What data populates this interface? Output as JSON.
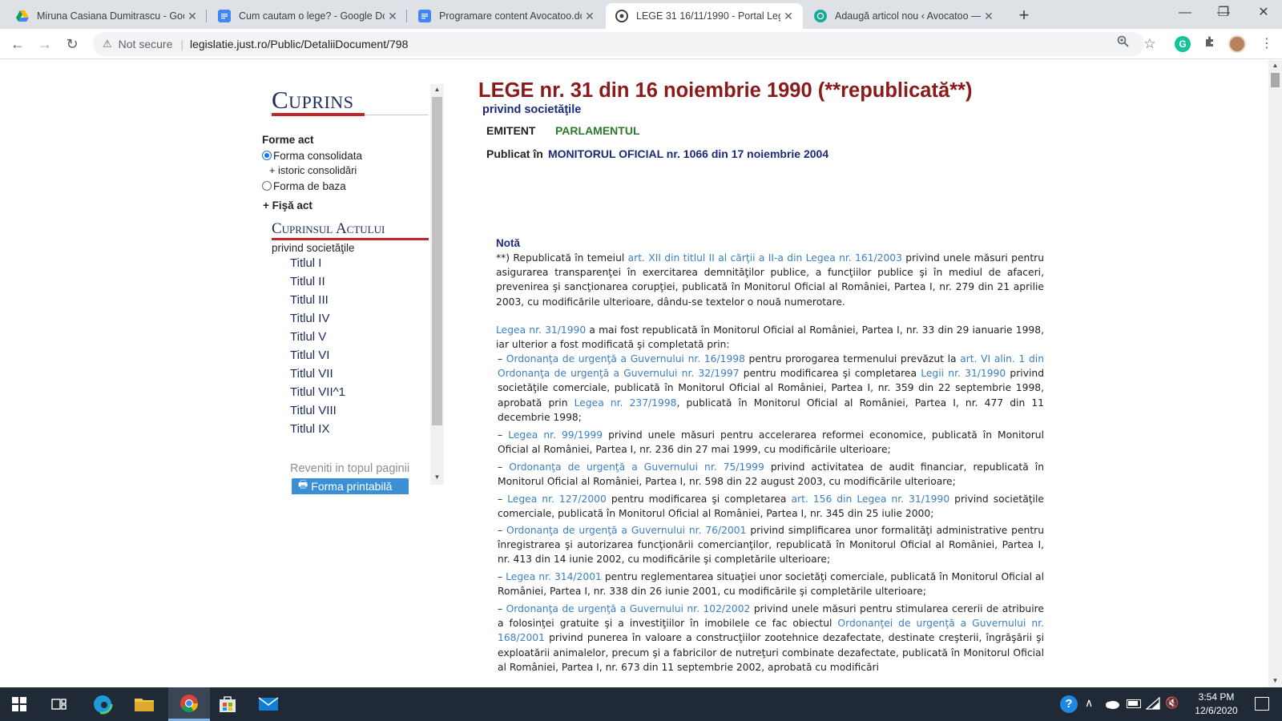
{
  "browser": {
    "tabs": [
      {
        "label": "Miruna Casiana Dumitrascu - Goo",
        "icon": "google-drive-icon"
      },
      {
        "label": "Cum cautam o lege? - Google Do",
        "icon": "google-docs-icon"
      },
      {
        "label": "Programare content Avocatoo.do",
        "icon": "google-docs-icon"
      },
      {
        "label": "LEGE 31 16/11/1990 - Portal Legi",
        "icon": "portal-legislativ-icon",
        "active": true
      },
      {
        "label": "Adaugă articol nou ‹ Avocatoo —",
        "icon": "wordpress-icon"
      }
    ],
    "security_label": "Not secure",
    "url": "legislatie.just.ro/Public/DetaliiDocument/798"
  },
  "sidebar": {
    "heading": "Cuprins",
    "forme_act_label": "Forme act",
    "forma_consolidata": "Forma consolidata",
    "istoric": "+ istoric consolidări",
    "forma_baza": "Forma de baza",
    "fisa_act": "+ Fişă act",
    "cuprinsul_heading": "Cuprinsul Actului",
    "cuprinsul_sub": "privind societăţile",
    "titluri": [
      "Titlul I",
      "Titlul II",
      "Titlul III",
      "Titlul IV",
      "Titlul V",
      "Titlul VI",
      "Titlul VII",
      "Titlul VII^1",
      "Titlul VIII",
      "Titlul IX"
    ],
    "back_to_top": "Reveniti in topul paginii",
    "print_button": "Forma printabilă"
  },
  "document": {
    "title": "LEGE nr. 31 din 16 noiembrie 1990 (**republicată**)",
    "subtitle": "privind societăţile",
    "emitent_label": "EMITENT",
    "emitent_value": "PARLAMENTUL",
    "publicat_label": "Publicat în",
    "publicat_value": "MONITORUL OFICIAL nr. 1066 din 17 noiembrie 2004",
    "nota_heading": "Notă",
    "p1": {
      "a": "**) Republicată în temeiul ",
      "link1": "art. XII din titlul II al cărţii a II-a din Legea nr. 161/2003",
      "b": " privind unele măsuri pentru asigurarea transparenţei în exercitarea demnităţilor publice, a funcţiilor publice şi în mediul de afaceri, prevenirea şi sancţionarea corupţiei, publicată în Monitorul Oficial al României, Partea I, nr. 279 din 21 aprilie 2003, cu modificările ulterioare, dându-se textelor o nouă numerotare."
    },
    "p2": {
      "link1": "Legea nr. 31/1990",
      "a": " a mai fost republicată în Monitorul Oficial al României, Partea I, nr. 33 din 29 ianuarie 1998, iar ulterior a fost modificată şi completată prin:"
    },
    "item1": {
      "dash": "– ",
      "link1": "Ordonanţa de urgenţă a Guvernului nr. 16/1998",
      "a": " pentru prorogarea termenului prevăzut la ",
      "link2": "art. VI alin. 1 din Ordonanţa de urgenţă a Guvernului nr. 32/1997",
      "b": " pentru modificarea şi completarea ",
      "link3": "Legii nr. 31/1990",
      "c": " privind societăţile comerciale, publicată în Monitorul Oficial al României, Partea I, nr. 359 din 22 septembrie 1998, aprobată prin ",
      "link4": "Legea nr. 237/1998",
      "d": ", publicată în Monitorul Oficial al României, Partea I, nr. 477 din 11 decembrie 1998;"
    },
    "item2": {
      "dash": "– ",
      "link1": "Legea nr. 99/1999",
      "a": " privind unele măsuri pentru accelerarea reformei economice, publicată în Monitorul Oficial al României, Partea I, nr. 236 din 27 mai 1999, cu modificările ulterioare;"
    },
    "item3": {
      "dash": "– ",
      "link1": "Ordonanţa de urgenţă a Guvernului nr. 75/1999",
      "a": " privind activitatea de audit financiar, republicată în Monitorul Oficial al României, Partea I, nr. 598 din 22 august 2003, cu modificările ulterioare;"
    },
    "item4": {
      "dash": "– ",
      "link1": "Legea nr. 127/2000",
      "a": " pentru modificarea şi completarea ",
      "link2": "art. 156 din Legea nr. 31/1990",
      "b": " privind societăţile comerciale, publicată în Monitorul Oficial al României, Partea I, nr. 345 din 25 iulie 2000;"
    },
    "item5": {
      "dash": "– ",
      "link1": "Ordonanţa de urgenţă a Guvernului nr. 76/2001",
      "a": " privind simplificarea unor formalităţi administrative pentru înregistrarea şi autorizarea funcţionării comercianţilor, republicată în Monitorul Oficial al României, Partea I, nr. 413 din 14 iunie 2002, cu modificările şi completările ulterioare;"
    },
    "item6": {
      "dash": "– ",
      "link1": "Legea nr. 314/2001",
      "a": " pentru reglementarea situaţiei unor societăţi comerciale, publicată în Monitorul Oficial al României, Partea I, nr. 338 din 26 iunie 2001, cu modificările şi completările ulterioare;"
    },
    "item7": {
      "dash": "– ",
      "link1": "Ordonanţa de urgenţă a Guvernului nr. 102/2002",
      "a": " privind unele măsuri pentru stimularea cererii de atribuire a folosinţei gratuite şi a investiţiilor în imobilele ce fac obiectul ",
      "link2": "Ordonanţei de urgenţă a Guvernului nr. 168/2001",
      "b": " privind punerea în valoare a construcţiilor zootehnice dezafectate, destinate creşterii, îngrăşării şi exploatării animalelor, precum şi a fabricilor de nutreţuri combinate dezafectate, publicată în Monitorul Oficial al României, Partea I, nr. 673 din 11 septembrie 2002, aprobată cu modificări"
    }
  },
  "taskbar": {
    "time": "3:54 PM",
    "date": "12/6/2020"
  },
  "colors": {
    "title_red": "#8b1a1a",
    "navy": "#1c2a5a",
    "link_blue": "#3b7fc4",
    "emitent_green": "#2a7a2a",
    "accent_red": "#c0272d",
    "taskbar": "#1f2a36"
  }
}
